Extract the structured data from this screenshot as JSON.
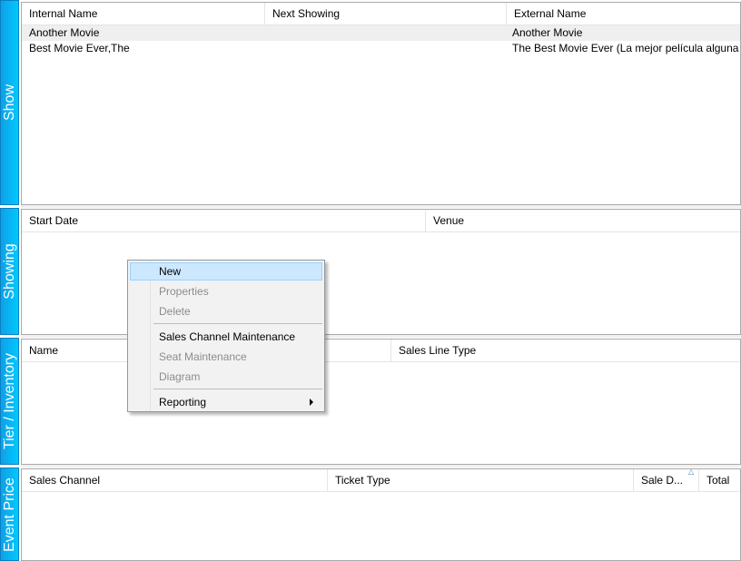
{
  "bands": {
    "show": "Show",
    "showing": "Showing",
    "tier": "Tier / Inventory",
    "event_price": "Event Price"
  },
  "show_panel": {
    "columns": [
      "Internal Name",
      "Next Showing",
      "External Name"
    ],
    "rows": [
      {
        "internal_name": "Another Movie",
        "next_showing": "",
        "external_name": "Another Movie"
      },
      {
        "internal_name": "Best Movie Ever,The",
        "next_showing": "",
        "external_name": "The Best Movie Ever (La mejor película alguna vez)"
      }
    ]
  },
  "showing_panel": {
    "columns": [
      "Start Date",
      "Venue"
    ]
  },
  "tier_panel": {
    "columns": [
      "Name",
      "",
      "Sales Line Type"
    ]
  },
  "event_price_panel": {
    "columns": [
      "Sales Channel",
      "Ticket Type",
      "Sale D...",
      "Total"
    ],
    "sort_icon": "sort-ascending-icon"
  },
  "context_menu": {
    "items": [
      {
        "label": "New",
        "enabled": true,
        "highlighted": true
      },
      {
        "label": "Properties",
        "enabled": false
      },
      {
        "label": "Delete",
        "enabled": false
      },
      {
        "label": "Sales Channel Maintenance",
        "enabled": true
      },
      {
        "label": "Seat Maintenance",
        "enabled": false
      },
      {
        "label": "Diagram",
        "enabled": false
      },
      {
        "label": "Reporting",
        "enabled": true,
        "submenu": true
      }
    ]
  }
}
